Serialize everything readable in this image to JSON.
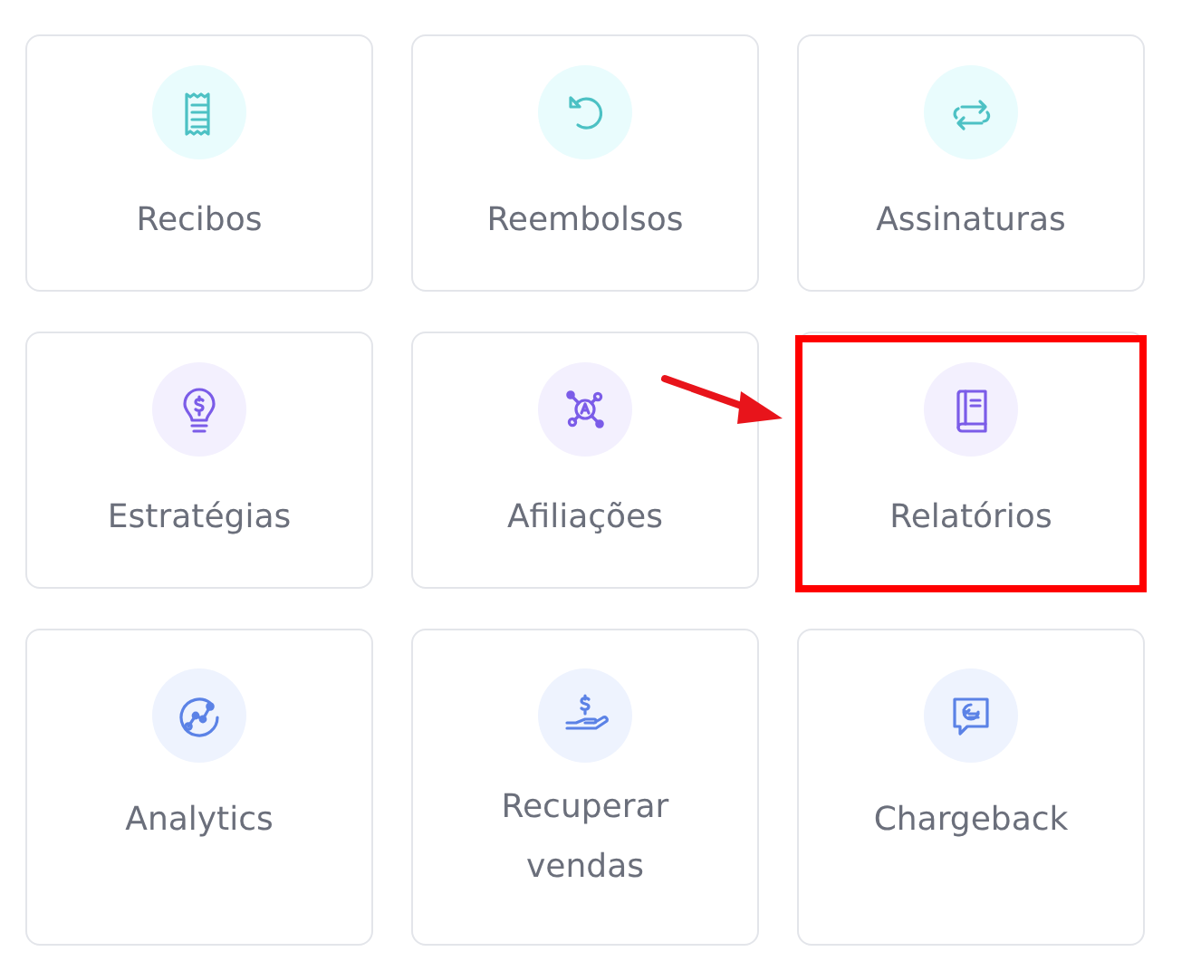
{
  "tiles": [
    {
      "label": "Recibos",
      "kind": "receipt",
      "highlighted": false
    },
    {
      "label": "Reembolsos",
      "kind": "undo",
      "highlighted": false
    },
    {
      "label": "Assinaturas",
      "kind": "repeat",
      "highlighted": false
    },
    {
      "label": "Estratégias",
      "kind": "bulb",
      "highlighted": false
    },
    {
      "label": "Afiliações",
      "kind": "network",
      "highlighted": false
    },
    {
      "label": "Relatórios",
      "kind": "book",
      "highlighted": true
    },
    {
      "label": "Analytics",
      "kind": "chart",
      "highlighted": false
    },
    {
      "label": "Recuperar vendas",
      "kind": "hand",
      "highlighted": false
    },
    {
      "label": "Chargeback",
      "kind": "chat",
      "highlighted": false
    }
  ]
}
